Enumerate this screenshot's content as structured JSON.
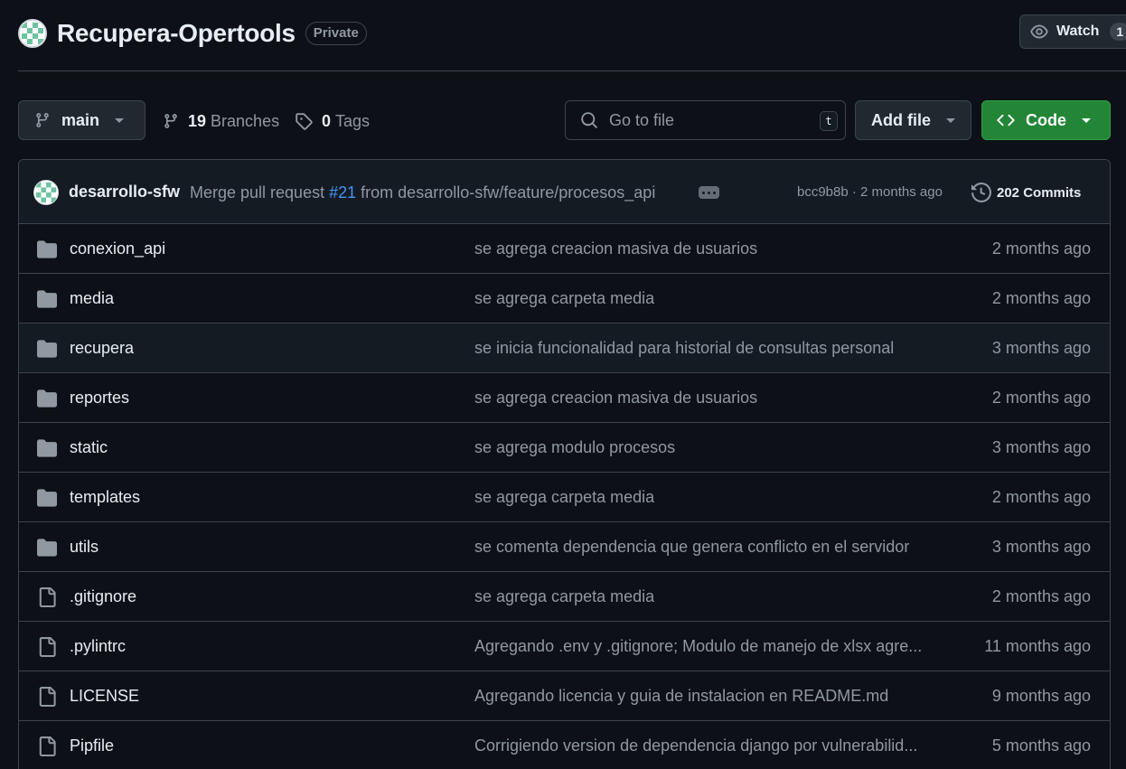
{
  "repo": {
    "name": "Recupera-Opertools",
    "visibility": "Private",
    "watch_label": "Watch",
    "watch_count": "1"
  },
  "toolbar": {
    "branch": "main",
    "branches_count": "19",
    "branches_label": "Branches",
    "tags_count": "0",
    "tags_label": "Tags",
    "search_placeholder": "Go to file",
    "search_shortcut": "t",
    "add_file_label": "Add file",
    "code_label": "Code"
  },
  "latest_commit": {
    "author": "desarrollo-sfw",
    "message_prefix": "Merge pull request",
    "pr_number": "#21",
    "message_suffix": "from desarrollo-sfw/feature/procesos_api",
    "sha_time": "bcc9b8b · 2 months ago",
    "commits_count": "202 Commits"
  },
  "files": [
    {
      "type": "folder",
      "name": "conexion_api",
      "message": "se agrega creacion masiva de usuarios",
      "date": "2 months ago"
    },
    {
      "type": "folder",
      "name": "media",
      "message": "se agrega carpeta media",
      "date": "2 months ago"
    },
    {
      "type": "folder",
      "name": "recupera",
      "message": "se inicia funcionalidad para historial de consultas personal",
      "date": "3 months ago"
    },
    {
      "type": "folder",
      "name": "reportes",
      "message": "se agrega creacion masiva de usuarios",
      "date": "2 months ago"
    },
    {
      "type": "folder",
      "name": "static",
      "message": "se agrega modulo procesos",
      "date": "3 months ago"
    },
    {
      "type": "folder",
      "name": "templates",
      "message": "se agrega carpeta media",
      "date": "2 months ago"
    },
    {
      "type": "folder",
      "name": "utils",
      "message": "se comenta dependencia que genera conflicto en el servidor",
      "date": "3 months ago"
    },
    {
      "type": "file",
      "name": ".gitignore",
      "message": "se agrega carpeta media",
      "date": "2 months ago"
    },
    {
      "type": "file",
      "name": ".pylintrc",
      "message": "Agregando .env y .gitignore; Modulo de manejo de xlsx agre...",
      "date": "11 months ago"
    },
    {
      "type": "file",
      "name": "LICENSE",
      "message": "Agregando licencia y guia de instalacion en README.md",
      "date": "9 months ago"
    },
    {
      "type": "file",
      "name": "Pipfile",
      "message": "Corrigiendo version de dependencia django por vulnerabilid...",
      "date": "5 months ago"
    }
  ],
  "icons": {
    "folder": "folder-icon",
    "file": "file-icon"
  },
  "colors": {
    "background": "#0d1117",
    "code_button": "#238636",
    "link": "#4493f8",
    "muted": "#9198a1",
    "border": "#3d444d"
  }
}
